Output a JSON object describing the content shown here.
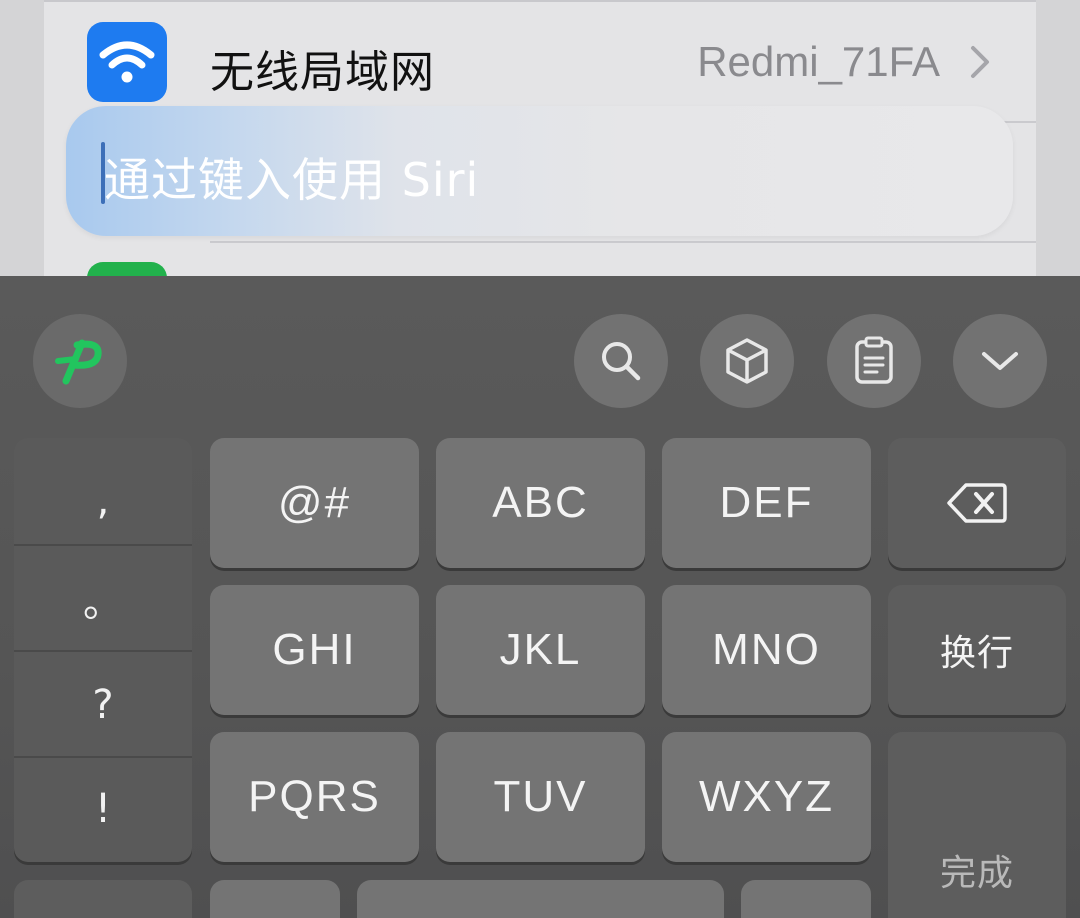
{
  "settings": {
    "wifi": {
      "label": "无线局域网",
      "value": "Redmi_71FA",
      "icon": "wifi-icon",
      "icon_color": "#1e7bf0"
    },
    "next_icon_color": "#22b14c"
  },
  "siri": {
    "placeholder": "通过键入使用 Siri"
  },
  "keyboard": {
    "toolbar": {
      "logo_icon": "p-logo-icon",
      "logo_color": "#22c55e",
      "tools": [
        "search-icon",
        "cube-icon",
        "clipboard-icon",
        "chevron-down-icon"
      ]
    },
    "punctuation": [
      ",",
      "。",
      "?",
      "!"
    ],
    "keys": {
      "at": "@#",
      "abc": "ABC",
      "def": "DEF",
      "ghi": "GHI",
      "jkl": "JKL",
      "mno": "MNO",
      "pqrs": "PQRS",
      "tuv": "TUV",
      "wxyz": "WXYZ"
    },
    "newline_label": "换行",
    "done_label": "完成",
    "backspace_icon": "backspace-icon"
  }
}
